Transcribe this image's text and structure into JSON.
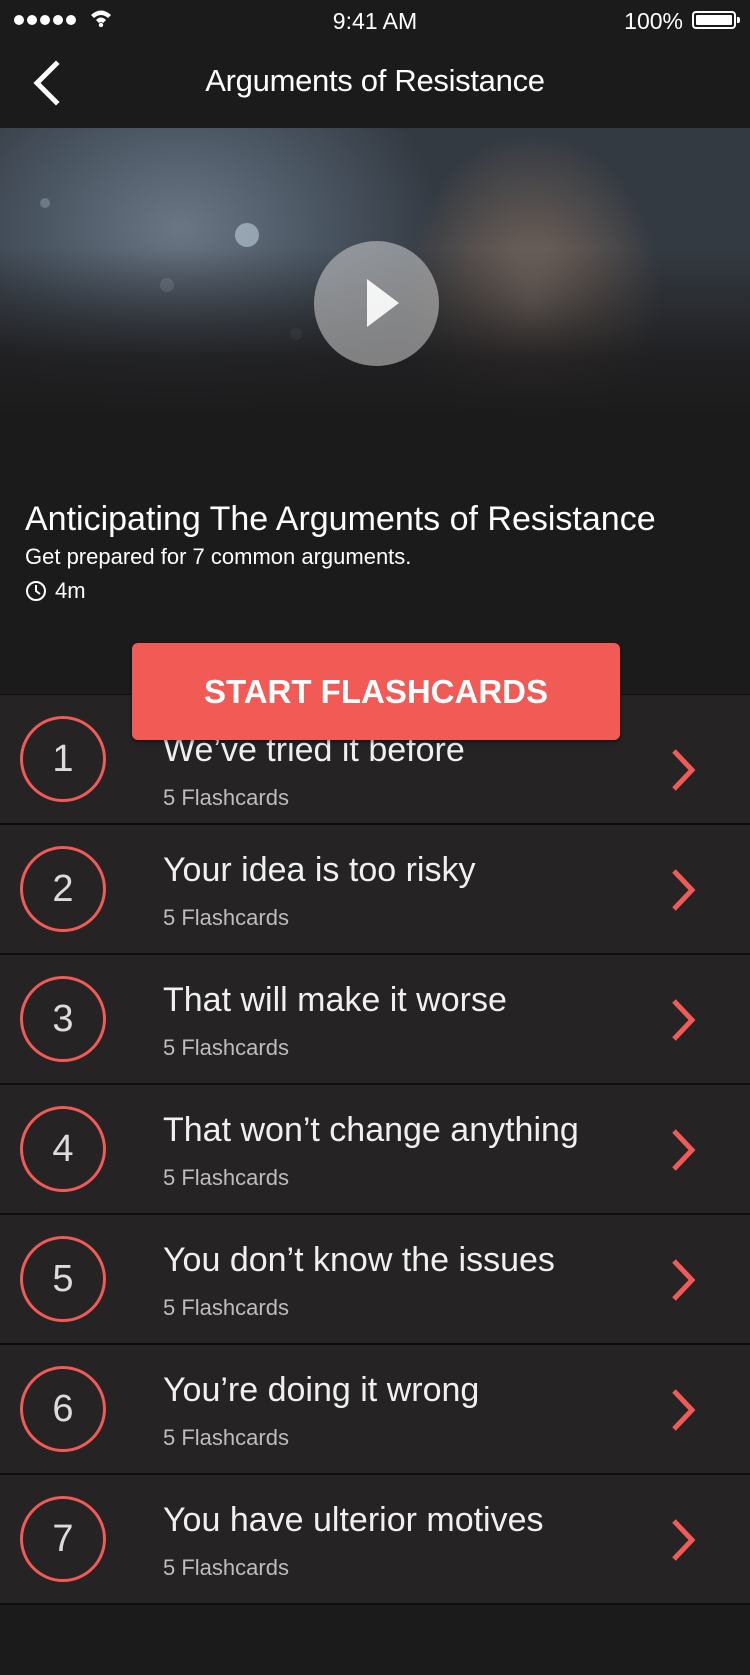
{
  "status_bar": {
    "time": "9:41 AM",
    "battery": "100%"
  },
  "nav": {
    "title": "Arguments of Resistance"
  },
  "lesson": {
    "title": "Anticipating The Arguments of Resistance",
    "subtitle": "Get prepared for 7 common arguments.",
    "duration": "4m"
  },
  "cta": {
    "label": "START FLASHCARDS"
  },
  "arguments": [
    {
      "number": "1",
      "title": "We’ve tried it before",
      "count": "5 Flashcards"
    },
    {
      "number": "2",
      "title": "Your idea is too risky",
      "count": "5 Flashcards"
    },
    {
      "number": "3",
      "title": "That will make it worse",
      "count": "5 Flashcards"
    },
    {
      "number": "4",
      "title": "That won’t change anything",
      "count": "5 Flashcards"
    },
    {
      "number": "5",
      "title": "You don’t know the issues",
      "count": "5 Flashcards"
    },
    {
      "number": "6",
      "title": "You’re doing it wrong",
      "count": "5 Flashcards"
    },
    {
      "number": "7",
      "title": "You have ulterior motives",
      "count": "5 Flashcards"
    }
  ],
  "colors": {
    "accent": "#f25a56",
    "background": "#1c1b1c",
    "list_background": "#252324"
  },
  "icons": {
    "back": "chevron-left-icon",
    "play": "play-icon",
    "clock": "clock-icon",
    "row": "chevron-right-icon"
  }
}
